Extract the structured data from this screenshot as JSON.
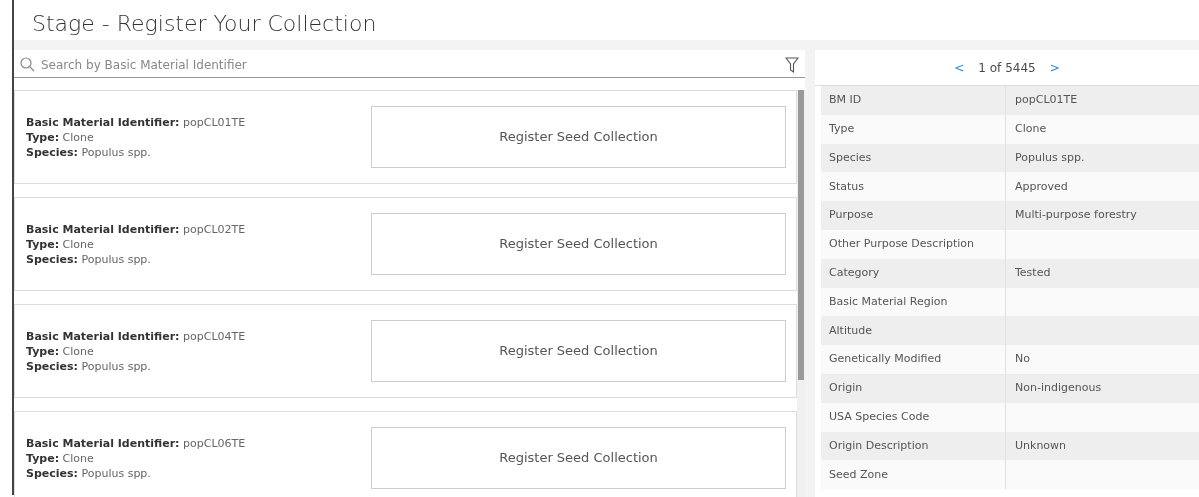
{
  "page_title": "Stage - Register Your Collection",
  "search": {
    "placeholder": "Search by Basic Material Identifier"
  },
  "records": [
    {
      "fields": [
        {
          "label": "Basic Material Identifier:",
          "value": "popCL01TE"
        },
        {
          "label": "Type:",
          "value": "Clone"
        },
        {
          "label": "Species:",
          "value": "Populus spp."
        }
      ],
      "action": "Register Seed Collection"
    },
    {
      "fields": [
        {
          "label": "Basic Material Identifier:",
          "value": "popCL02TE"
        },
        {
          "label": "Type:",
          "value": "Clone"
        },
        {
          "label": "Species:",
          "value": "Populus spp."
        }
      ],
      "action": "Register Seed Collection"
    },
    {
      "fields": [
        {
          "label": "Basic Material Identifier:",
          "value": "popCL04TE"
        },
        {
          "label": "Type:",
          "value": "Clone"
        },
        {
          "label": "Species:",
          "value": "Populus spp."
        }
      ],
      "action": "Register Seed Collection"
    },
    {
      "fields": [
        {
          "label": "Basic Material Identifier:",
          "value": "popCL06TE"
        },
        {
          "label": "Type:",
          "value": "Clone"
        },
        {
          "label": "Species:",
          "value": "Populus spp."
        }
      ],
      "action": "Register Seed Collection"
    }
  ],
  "pager": {
    "prev": "<",
    "text": "1 of 5445",
    "next": ">"
  },
  "details": [
    {
      "label": "BM ID",
      "value": "popCL01TE"
    },
    {
      "label": "Type",
      "value": "Clone"
    },
    {
      "label": "Species",
      "value": "Populus spp."
    },
    {
      "label": "Status",
      "value": "Approved"
    },
    {
      "label": "Purpose",
      "value": "Multi-purpose forestry"
    },
    {
      "label": "Other Purpose Description"
    },
    {
      "label": "Category",
      "value": "Tested"
    },
    {
      "label": "Basic Material Region"
    },
    {
      "label": "Altitude"
    },
    {
      "label": "Genetically Modified",
      "value": "No"
    },
    {
      "label": "Origin",
      "value": "Non-indigenous"
    },
    {
      "label": "USA Species Code"
    },
    {
      "label": "Origin Description",
      "value": "Unknown"
    },
    {
      "label": "Seed Zone"
    }
  ]
}
